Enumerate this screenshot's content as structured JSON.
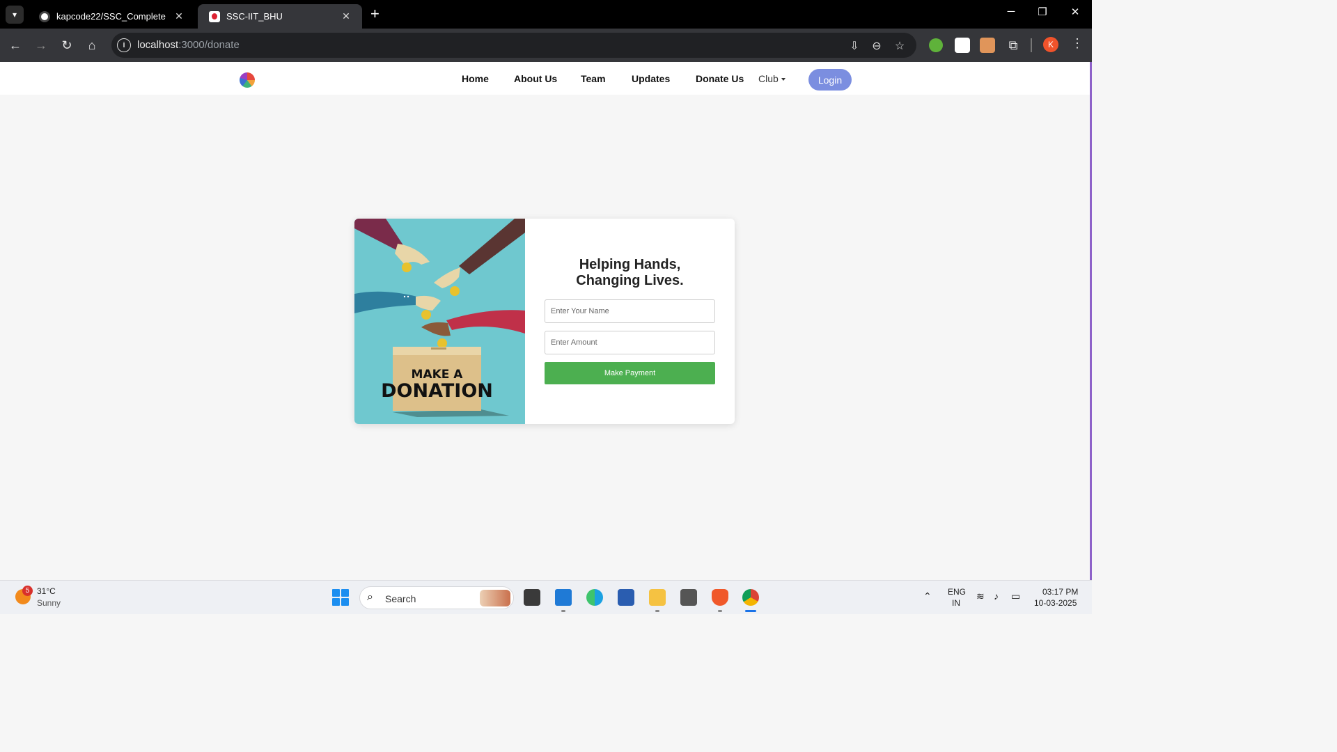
{
  "browser": {
    "tabs": [
      {
        "title": "kapcode22/SSC_Complete",
        "active": false
      },
      {
        "title": "SSC-IIT_BHU",
        "active": true
      }
    ],
    "url_host": "localhost",
    "url_path": ":3000/donate",
    "icons": [
      "back-icon",
      "forward-icon",
      "reload-icon",
      "home-icon",
      "site-info-icon",
      "install-app-icon",
      "zoom-icon",
      "bookmark-star-icon",
      "extensions-icon",
      "profile-avatar",
      "menu-icon"
    ],
    "profile_initial": "K"
  },
  "navbar": {
    "links": [
      "Home",
      "About Us",
      "Team",
      "Updates",
      "Donate Us"
    ],
    "club_label": "Club",
    "login_label": "Login"
  },
  "donate": {
    "banner_line1": "MAKE A",
    "banner_line2": "DONATION",
    "heading_line1": "Helping Hands,",
    "heading_line2": "Changing Lives.",
    "name_placeholder": "Enter Your Name",
    "amount_placeholder": "Enter Amount",
    "pay_label": "Make Payment"
  },
  "taskbar": {
    "weather_temp": "31°C",
    "weather_desc": "Sunny",
    "weather_badge": "5",
    "search_label": "Search",
    "lang_line1": "ENG",
    "lang_line2": "IN",
    "time": "03:17 PM",
    "date": "10-03-2025"
  },
  "colors": {
    "accent": "#7b8ee0",
    "pay_button": "#4caf50",
    "illustration_bg": "#6fc8cf"
  }
}
